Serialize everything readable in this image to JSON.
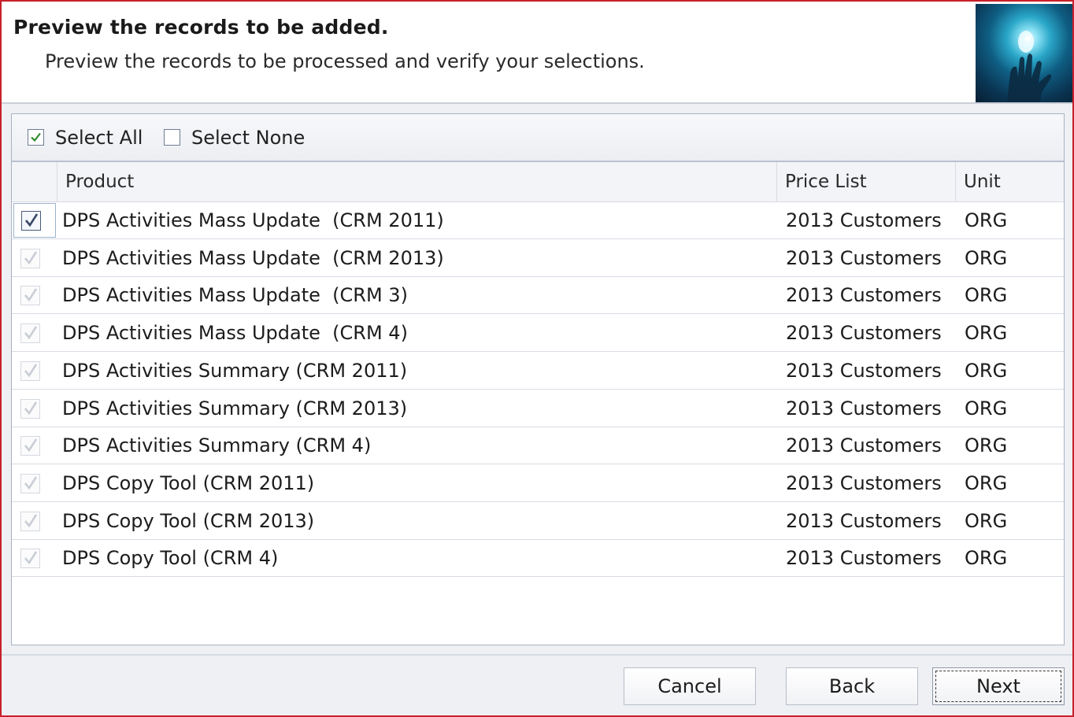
{
  "header": {
    "title": "Preview the records to be added.",
    "subtitle": "Preview the records to be processed and verify your selections."
  },
  "selection": {
    "select_all_label": "Select All",
    "select_all_checked": true,
    "select_none_label": "Select None",
    "select_none_checked": false
  },
  "grid": {
    "columns": [
      "Product",
      "Price List",
      "Unit"
    ],
    "rows": [
      {
        "product": "DPS Activities Mass Update  (CRM 2011)",
        "price_list": "2013 Customers",
        "unit": "ORG",
        "checked": true,
        "active": true
      },
      {
        "product": "DPS Activities Mass Update  (CRM 2013)",
        "price_list": "2013 Customers",
        "unit": "ORG",
        "checked": true,
        "active": false
      },
      {
        "product": "DPS Activities Mass Update  (CRM 3)",
        "price_list": "2013 Customers",
        "unit": "ORG",
        "checked": true,
        "active": false
      },
      {
        "product": "DPS Activities Mass Update  (CRM 4)",
        "price_list": "2013 Customers",
        "unit": "ORG",
        "checked": true,
        "active": false
      },
      {
        "product": "DPS Activities Summary (CRM 2011)",
        "price_list": "2013 Customers",
        "unit": "ORG",
        "checked": true,
        "active": false
      },
      {
        "product": "DPS Activities Summary (CRM 2013)",
        "price_list": "2013 Customers",
        "unit": "ORG",
        "checked": true,
        "active": false
      },
      {
        "product": "DPS Activities Summary (CRM 4)",
        "price_list": "2013 Customers",
        "unit": "ORG",
        "checked": true,
        "active": false
      },
      {
        "product": "DPS Copy Tool (CRM 2011)",
        "price_list": "2013 Customers",
        "unit": "ORG",
        "checked": true,
        "active": false
      },
      {
        "product": "DPS Copy Tool (CRM 2013)",
        "price_list": "2013 Customers",
        "unit": "ORG",
        "checked": true,
        "active": false
      },
      {
        "product": "DPS Copy Tool (CRM 4)",
        "price_list": "2013 Customers",
        "unit": "ORG",
        "checked": true,
        "active": false
      }
    ]
  },
  "buttons": {
    "cancel": "Cancel",
    "back": "Back",
    "next": "Next"
  },
  "icons": {
    "header_image": "glowing-hand-image",
    "checkbox_checked": "checkmark-icon"
  },
  "colors": {
    "window_border": "#c8202a",
    "check_active": "#3a4a66",
    "check_disabled": "#c9ced6"
  }
}
